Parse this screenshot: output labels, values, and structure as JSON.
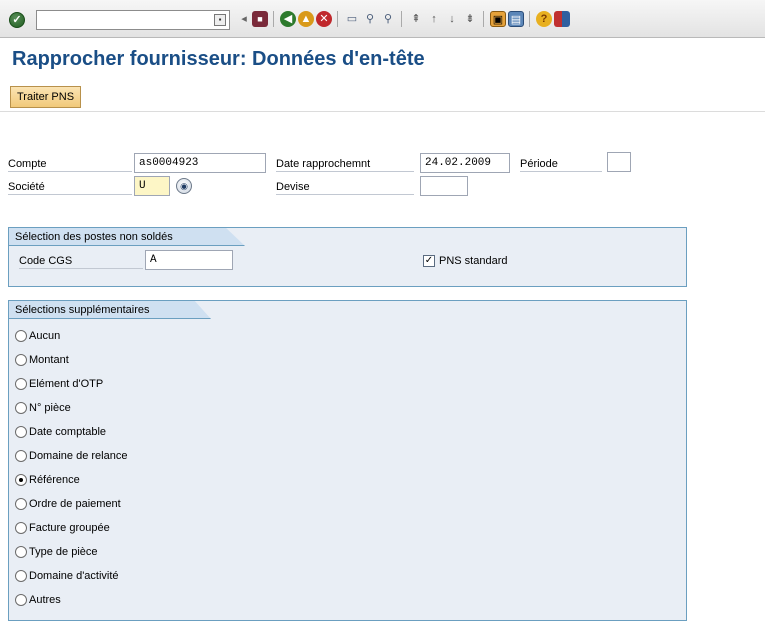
{
  "toolbar": {
    "ok_icon": "check-icon",
    "command_value": "",
    "icons": [
      "dropdown-icon",
      "back-arrow-icon",
      "save-icon",
      "back-icon",
      "exit-icon",
      "cancel-icon",
      "print-icon",
      "find-icon",
      "find-next-icon",
      "first-page-icon",
      "previous-page-icon",
      "next-page-icon",
      "last-page-icon",
      "create-session-icon",
      "shortcut-icon",
      "help-icon",
      "layout-icon"
    ]
  },
  "page": {
    "title": "Rapprocher fournisseur: Données d'en-tête"
  },
  "app_toolbar": {
    "traiter_label": "Traiter PNS"
  },
  "header_fields": {
    "compte_label": "Compte",
    "compte_value": "as0004923",
    "societe_label": "Société",
    "societe_value": "U",
    "date_label": "Date rapprochemnt",
    "date_value": "24.02.2009",
    "periode_label": "Période",
    "periode_value": "",
    "devise_label": "Devise",
    "devise_value": ""
  },
  "open_items": {
    "title": "Sélection des postes non soldés",
    "code_label": "Code CGS",
    "code_value": "A",
    "pns_label": "PNS standard",
    "pns_checked": true
  },
  "extra_selections": {
    "title": "Sélections supplémentaires",
    "options": [
      {
        "label": "Aucun",
        "selected": false
      },
      {
        "label": "Montant",
        "selected": false
      },
      {
        "label": "Elément d'OTP",
        "selected": false
      },
      {
        "label": "N° pièce",
        "selected": false
      },
      {
        "label": "Date comptable",
        "selected": false
      },
      {
        "label": "Domaine de relance",
        "selected": false
      },
      {
        "label": "Référence",
        "selected": true
      },
      {
        "label": "Ordre de paiement",
        "selected": false
      },
      {
        "label": "Facture groupée",
        "selected": false
      },
      {
        "label": "Type de pièce",
        "selected": false
      },
      {
        "label": "Domaine d'activité",
        "selected": false
      },
      {
        "label": "Autres",
        "selected": false
      }
    ]
  },
  "colors": {
    "title": "#1a4e86",
    "group_border": "#6b9fc0",
    "group_bg": "#e9eef5",
    "button_bg": "#f1c97a"
  }
}
